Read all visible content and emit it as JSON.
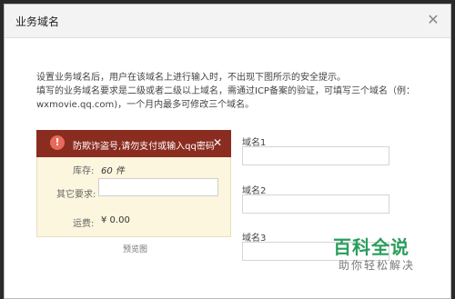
{
  "dialog": {
    "title": "业务域名",
    "close_glyph": "✕"
  },
  "description": {
    "line1": "设置业务域名后，用户在该域名上进行输入时，不出现下图所示的安全提示。",
    "line2": "填写的业务域名要求是二级或者二级以上域名，需通过ICP备案的验证，可填写三个域名（例：",
    "line3": "wxmovie.qq.com)，一个月内最多可修改三个域名。"
  },
  "preview": {
    "alert_icon": "!",
    "alert_text": "防欺诈盗号,请勿支付或输入qq密码",
    "alert_close": "✕",
    "stock_label": "库存:",
    "stock_value": "60 件",
    "other_label": "其它要求:",
    "shipping_label": "运费:",
    "shipping_value": "¥ 0.00",
    "caption": "预览图"
  },
  "domains": {
    "label1": "域名1",
    "label2": "域名2",
    "label3": "域名3",
    "value1": "",
    "value2": "",
    "value3": ""
  },
  "watermark": {
    "title": "百科全说",
    "subtitle": "助你轻松解决"
  }
}
